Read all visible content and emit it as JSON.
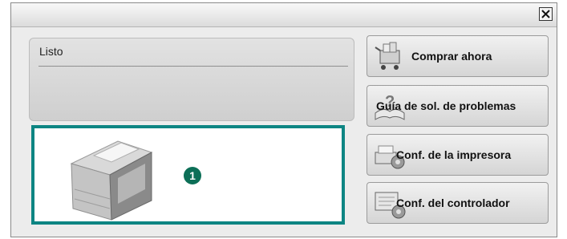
{
  "window": {
    "close_icon": "close-icon"
  },
  "status": {
    "text": "Listo"
  },
  "printer_area": {
    "callout_number": "1"
  },
  "buttons": [
    {
      "label": "Comprar ahora",
      "icon": "shopping-cart-icon"
    },
    {
      "label": "Guía de sol. de problemas",
      "icon": "troubleshooting-guide-icon"
    },
    {
      "label": "Conf. de la impresora",
      "icon": "printer-settings-icon"
    },
    {
      "label": "Conf. del controlador",
      "icon": "driver-settings-icon"
    }
  ],
  "colors": {
    "highlight_border": "#0d8583",
    "callout": "#0c6f57"
  }
}
